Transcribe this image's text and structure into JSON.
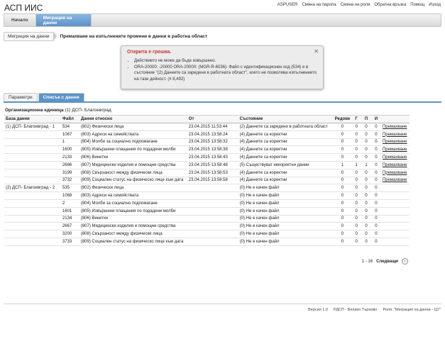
{
  "app": {
    "title": "АСП ИИС"
  },
  "top_links": [
    "ASPUSER",
    "Смяна на парола",
    "Смяна на роля",
    "Обратна връзка",
    "Помощ",
    "Изход"
  ],
  "nav": {
    "tabs": [
      {
        "label": "Начало"
      },
      {
        "label": "Миграция на данни"
      }
    ]
  },
  "breadcrumb": {
    "first": "Миграция на данни",
    "current": "Премахване на изпълнените промени в данни в работна област"
  },
  "error": {
    "title": "Открита е грешка.",
    "close": "✕",
    "items": [
      "Действието не може да бъде извършено.",
      "ORA-20000: -20000 ORA-20000: (MGR-R-6036): Файл с идентификационен код (534) е в състояние \"(2) Данните са заредени в работната област\", което не позволява изпълнението на тази дейност. (# 8,492)"
    ]
  },
  "tabs": [
    {
      "label": "Параметри"
    },
    {
      "label": "Списък с данни"
    }
  ],
  "org": {
    "label": "Организационна единица",
    "value": "(1) ДСП- Благоевград"
  },
  "table": {
    "headers": [
      "База данни",
      "Файл",
      "Данни относно",
      "От",
      "Състояние",
      "Редове",
      "Г",
      "П",
      "И",
      ""
    ],
    "rows": [
      [
        "(1) ДСП- Благоевград - 1",
        "534",
        "(802) Физически лица",
        "23.04.2015 11:53:44",
        "(2) Данните са заредени в работната област",
        "0",
        "0",
        "0",
        "0",
        "Премахване"
      ],
      [
        "",
        "1067",
        "(803) Адреси на семействата",
        "23.04.2015 13:58:24",
        "(4) Данните са коректни",
        "0",
        "0",
        "0",
        "0",
        "Премахване"
      ],
      [
        "",
        "1",
        "(804) Молби за социално подпомагане",
        "23.04.2015 13:58:32",
        "(4) Данните са коректни",
        "0",
        "0",
        "0",
        "0",
        "Премахване"
      ],
      [
        "",
        "1600",
        "(805) Извършени плащания по подадени молби",
        "23.04.2015 13:58:38",
        "(4) Данните са коректни",
        "0",
        "0",
        "0",
        "0",
        "Премахване"
      ],
      [
        "",
        "2133",
        "(806) Винетки",
        "23.04.2015 13:58:43",
        "(4) Данните са коректни",
        "0",
        "0",
        "0",
        "0",
        "Премахване"
      ],
      [
        "",
        "2666",
        "(807) Медицински изделия и помощни средства",
        "23.04.2015 13:58:48",
        "(5) Съществуват некоректни данни",
        "1",
        "1",
        "1",
        "0",
        "Премахване"
      ],
      [
        "",
        "3199",
        "(808) Свързаност между физически лица",
        "23.04.2015 13:58:53",
        "(4) Данните са коректни",
        "0",
        "0",
        "0",
        "0",
        "Премахване"
      ],
      [
        "",
        "3732",
        "(809) Социален статус на физическо лице към дата",
        "23.04.2015 13:58:58",
        "(4) Данните са коректни",
        "0",
        "0",
        "0",
        "0",
        "Премахване"
      ],
      [
        "(2) ДСП- Благоевград - 2",
        "535",
        "(802) Физически лица",
        "",
        "(0) Не е качен файл",
        "0",
        "0",
        "0",
        "0",
        ""
      ],
      [
        "",
        "1068",
        "(803) Адреси на семействата",
        "",
        "(0) Не е качен файл",
        "0",
        "0",
        "0",
        "0",
        ""
      ],
      [
        "",
        "2",
        "(804) Молби за социално подпомагане",
        "",
        "(0) Не е качен файл",
        "0",
        "0",
        "0",
        "0",
        ""
      ],
      [
        "",
        "1601",
        "(805) Извършени плащания по подадени молби",
        "",
        "(0) Не е качен файл",
        "0",
        "0",
        "0",
        "0",
        ""
      ],
      [
        "",
        "2134",
        "(806) Винетки",
        "",
        "(0) Не е качен файл",
        "0",
        "0",
        "0",
        "0",
        ""
      ],
      [
        "",
        "2667",
        "(807) Медицински изделия и помощни средства",
        "",
        "(0) Не е качен файл",
        "0",
        "0",
        "0",
        "0",
        ""
      ],
      [
        "",
        "3200",
        "(808) Свързаност между физически лица",
        "",
        "(0) Не е качен файл",
        "0",
        "0",
        "0",
        "0",
        ""
      ],
      [
        "",
        "3733",
        "(809) Социален статус на физическо лице към дата",
        "",
        "(0) Не е качен файл",
        "0",
        "0",
        "0",
        "0",
        ""
      ]
    ]
  },
  "pager": {
    "range": "1 - 16",
    "next": "Следващи",
    "next_icon": "›"
  },
  "footer": {
    "version": "Версия 1.0",
    "region": "РДСП - Велико Търново",
    "role": "Роля: \"Миграция на данни - ЦУ\""
  },
  "colors": {
    "accent": "#5c93c8",
    "error": "#c0392b"
  }
}
